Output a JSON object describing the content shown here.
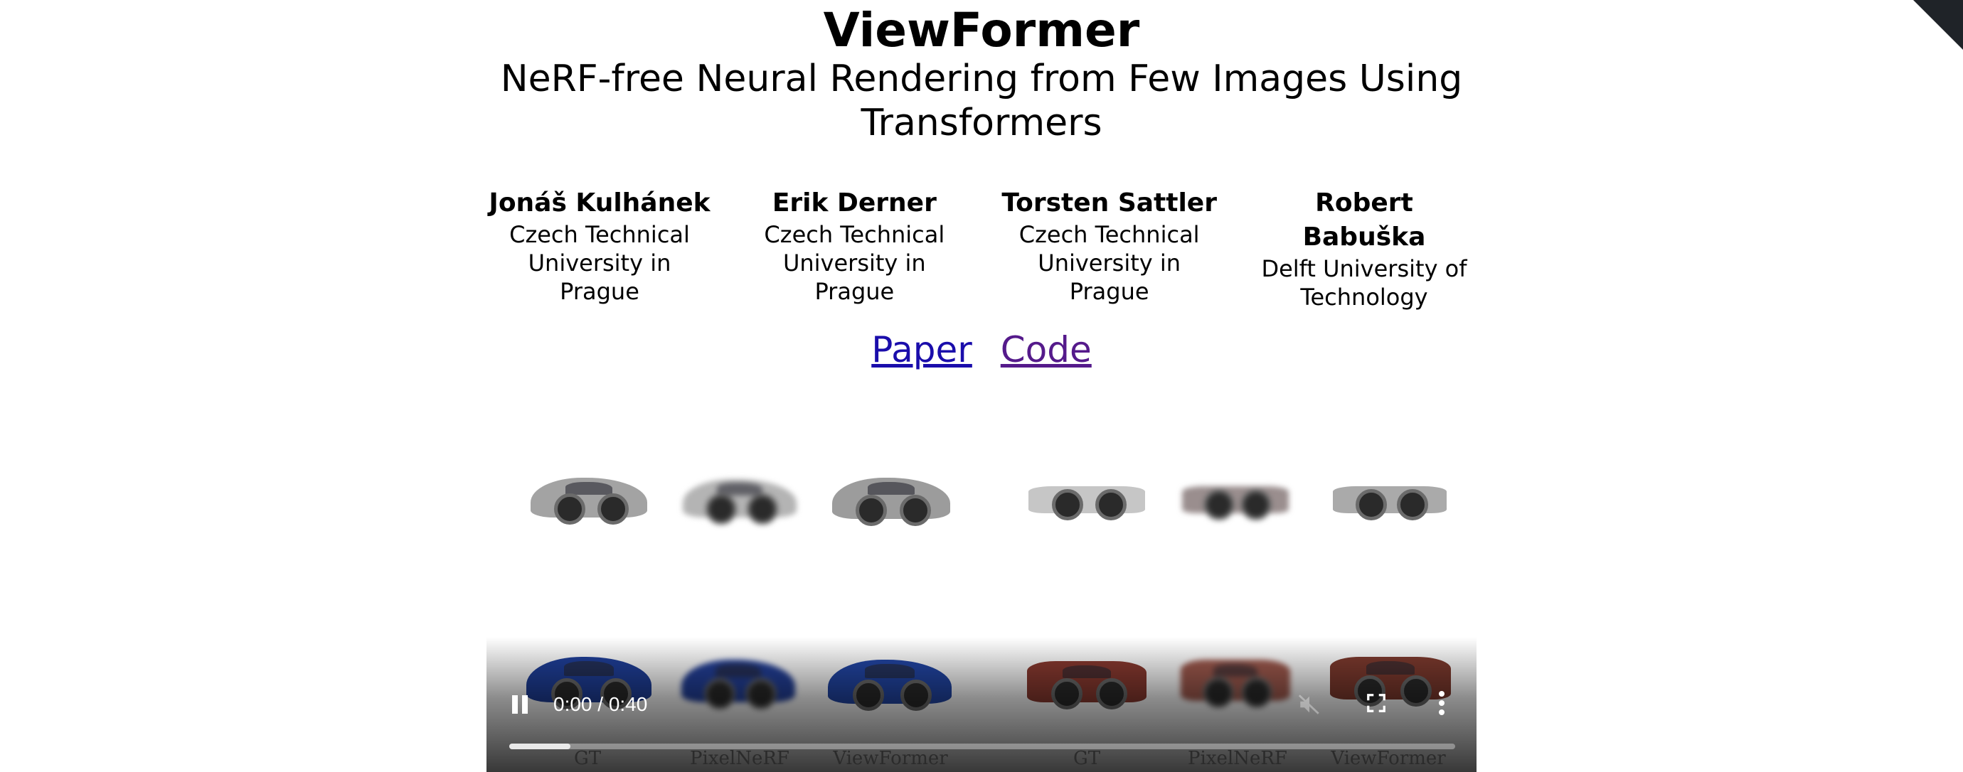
{
  "page": {
    "title": "ViewFormer",
    "subtitle_lines": [
      "NeRF-free Neural Rendering from Few Images Using",
      "Transformers"
    ]
  },
  "authors": [
    {
      "name": "Jonáš Kulhánek",
      "affiliation_lines": [
        "Czech Technical",
        "University in Prague"
      ]
    },
    {
      "name": "Erik Derner",
      "affiliation_lines": [
        "Czech Technical",
        "University in Prague"
      ]
    },
    {
      "name": "Torsten Sattler",
      "affiliation_lines": [
        "Czech Technical",
        "University in Prague"
      ]
    },
    {
      "name": "Robert Babuška",
      "affiliation_lines": [
        "Delft University of",
        "Technology"
      ]
    }
  ],
  "links": {
    "paper": "Paper",
    "code": "Code"
  },
  "video": {
    "column_labels": [
      "GT",
      "PixelNeRF",
      "ViewFormer",
      "GT",
      "PixelNeRF",
      "ViewFormer"
    ],
    "time_display": "0:00 / 0:40",
    "state": "playing",
    "muted": true,
    "progress_fraction": 0.0,
    "buffered_fraction": 0.065,
    "car_colors": {
      "silver_coupe": "#9a9a9a",
      "white_convertible": "#c9c9c9",
      "blue_minivan": "#1f3f9a",
      "red_suv": "#8a3a30"
    }
  },
  "icons": {
    "play_pause": "pause-icon",
    "mute": "volume-muted-icon",
    "fullscreen": "fullscreen-icon",
    "more": "more-vertical-icon"
  }
}
